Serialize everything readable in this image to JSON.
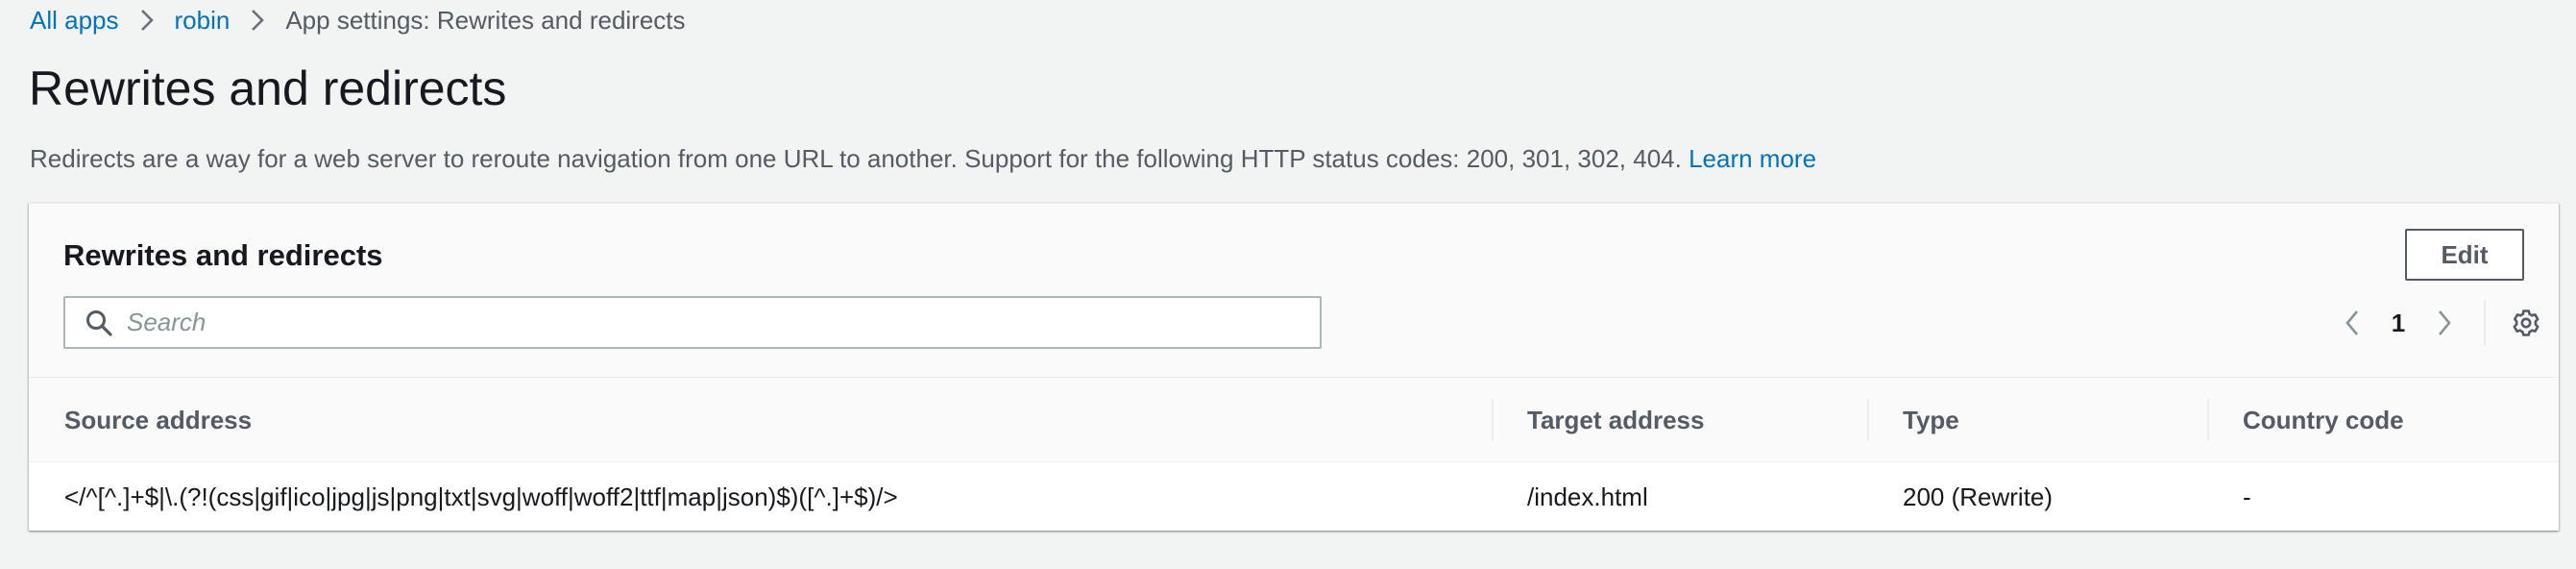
{
  "breadcrumb": {
    "items": [
      {
        "label": "All apps"
      },
      {
        "label": "robin"
      },
      {
        "label": "App settings: Rewrites and redirects"
      }
    ]
  },
  "page": {
    "title": "Rewrites and redirects",
    "description": "Redirects are a way for a web server to reroute navigation from one URL to another. Support for the following HTTP status codes: 200, 301, 302, 404.",
    "learn_more": "Learn more"
  },
  "panel": {
    "title": "Rewrites and redirects",
    "edit_label": "Edit",
    "search": {
      "placeholder": "Search",
      "value": ""
    },
    "pagination": {
      "current_page": "1"
    },
    "table": {
      "columns": [
        "Source address",
        "Target address",
        "Type",
        "Country code"
      ],
      "rows": [
        [
          "</^[^.]+$|\\.(?!(css|gif|ico|jpg|js|png|txt|svg|woff|woff2|ttf|map|json)$)([^.]+$)/>",
          "/index.html",
          "200 (Rewrite)",
          "-"
        ]
      ]
    }
  },
  "icons": {
    "breadcrumb_separator": "chevron-right-icon",
    "search": "search-icon",
    "prev_page": "chevron-left-icon",
    "next_page": "chevron-right-icon",
    "settings": "gear-icon"
  },
  "colors": {
    "link": "#0073bb",
    "page_background": "#f2f3f3",
    "panel_header": "#fafafa",
    "secondary_text": "#545b64",
    "border": "#aab7b8"
  }
}
